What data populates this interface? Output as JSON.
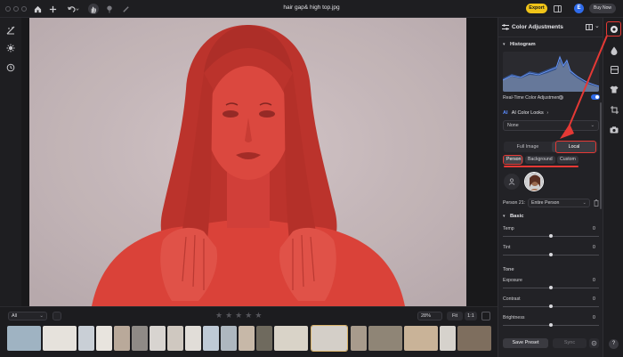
{
  "window": {
    "title": "hair gap& high top.jpg"
  },
  "titlebar": {
    "export_label": "Export",
    "account_initial": "E",
    "buy_label": "Buy Now"
  },
  "colors": {
    "accent_yellow": "#f0c419",
    "highlight_red": "#e53935",
    "toggle_blue": "#2f6bea",
    "mask_red": "#d9443a"
  },
  "panel": {
    "title": "Color Adjustments",
    "histogram_title": "Histogram",
    "realtime_label": "Real-Time Color Adjustments",
    "realtime_on": true,
    "ai_badge": "AI",
    "ai_looks_label": "AI Color Looks",
    "looks_value": "None",
    "scope_tabs": [
      "Full Image",
      "Local"
    ],
    "active_scope": "Local",
    "subject_tabs": [
      "Person",
      "Background",
      "Custom"
    ],
    "active_subject": "Person",
    "person_label": "Person 21:",
    "person_value": "Entire Person",
    "basic_title": "Basic",
    "temp": {
      "label": "Temp",
      "value": "0"
    },
    "tint": {
      "label": "Tint",
      "value": "0"
    },
    "tone_title": "Tone",
    "exposure": {
      "label": "Exposure",
      "value": "0"
    },
    "contrast": {
      "label": "Contrast",
      "value": "0"
    },
    "brightness": {
      "label": "Brightness",
      "value": "0"
    },
    "save_preset_label": "Save Preset",
    "sync_label": "Sync"
  },
  "filmstrip": {
    "filter_value": "All",
    "rating_stars": 5,
    "zoom_value": "28%",
    "fit_label": "Fit",
    "one_to_one_label": "1:1"
  },
  "icons": {
    "title_bar": [
      "home-icon",
      "add-icon",
      "undo-icon",
      "hand-tool-icon",
      "retouch-icon",
      "brush-icon",
      "sidebar-icon"
    ],
    "left_tools": [
      "enhance-icon",
      "settings-sun-icon",
      "history-icon"
    ],
    "right_rail": [
      "color-adjust-icon",
      "droplet-icon",
      "template-icon",
      "shirt-icon",
      "crop-icon",
      "camera-icon"
    ]
  }
}
